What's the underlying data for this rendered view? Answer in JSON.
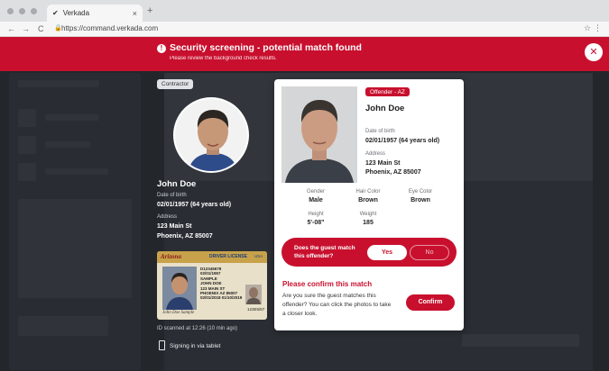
{
  "browser": {
    "tab_title": "Verkada",
    "url": "https://command.verkada.com",
    "new_tab": "+",
    "back": "←",
    "forward": "→",
    "reload": "C"
  },
  "banner": {
    "title": "Security screening - potential match found",
    "subtitle": "Please review the background check results."
  },
  "guest": {
    "badge": "Contractor",
    "name": "John Doe",
    "dob_label": "Date of birth",
    "dob": "02/01/1957 (64 years old)",
    "address_label": "Address",
    "address_line1": "123 Main St",
    "address_line2": "Phoenix, AZ 85007",
    "scanned": "ID scanned at 12:26 (10 min ago)",
    "sign_in": "Signing in via tablet"
  },
  "license": {
    "state": "Arizona",
    "title": "DRIVER LICENSE",
    "country": "USA",
    "lines": [
      "D12345678",
      "02/01/1957",
      "SAMPLE",
      "JOHN DOE",
      "123 MAIN ST",
      "PHOENIX AZ 85007",
      "02/01/2018  01/10/2019"
    ],
    "signature": "John Doe Sample",
    "code": "123E5/57"
  },
  "offender": {
    "badge": "Offender - AZ",
    "name": "John Doe",
    "dob_label": "Date of birth",
    "dob": "02/01/1957 (64 years old)",
    "address_label": "Address",
    "address_line1": "123 Main St",
    "address_line2": "Phoenix, AZ 85007",
    "gender_label": "Gender",
    "gender": "Male",
    "hair_label": "Hair Color",
    "hair": "Brown",
    "eye_label": "Eye Color",
    "eye": "Brown",
    "height_label": "Height",
    "height": "5'-08\"",
    "weight_label": "Weight",
    "weight": "185"
  },
  "match": {
    "question": "Does the guest match this offender?",
    "yes": "Yes",
    "no": "No"
  },
  "confirm": {
    "title": "Please confirm this match",
    "body": "Are you sure the guest matches this offender? You can click the photos to take a closer look.",
    "button": "Confirm"
  },
  "colors": {
    "brand_red": "#c8102e",
    "overlay": "#3c4046"
  }
}
